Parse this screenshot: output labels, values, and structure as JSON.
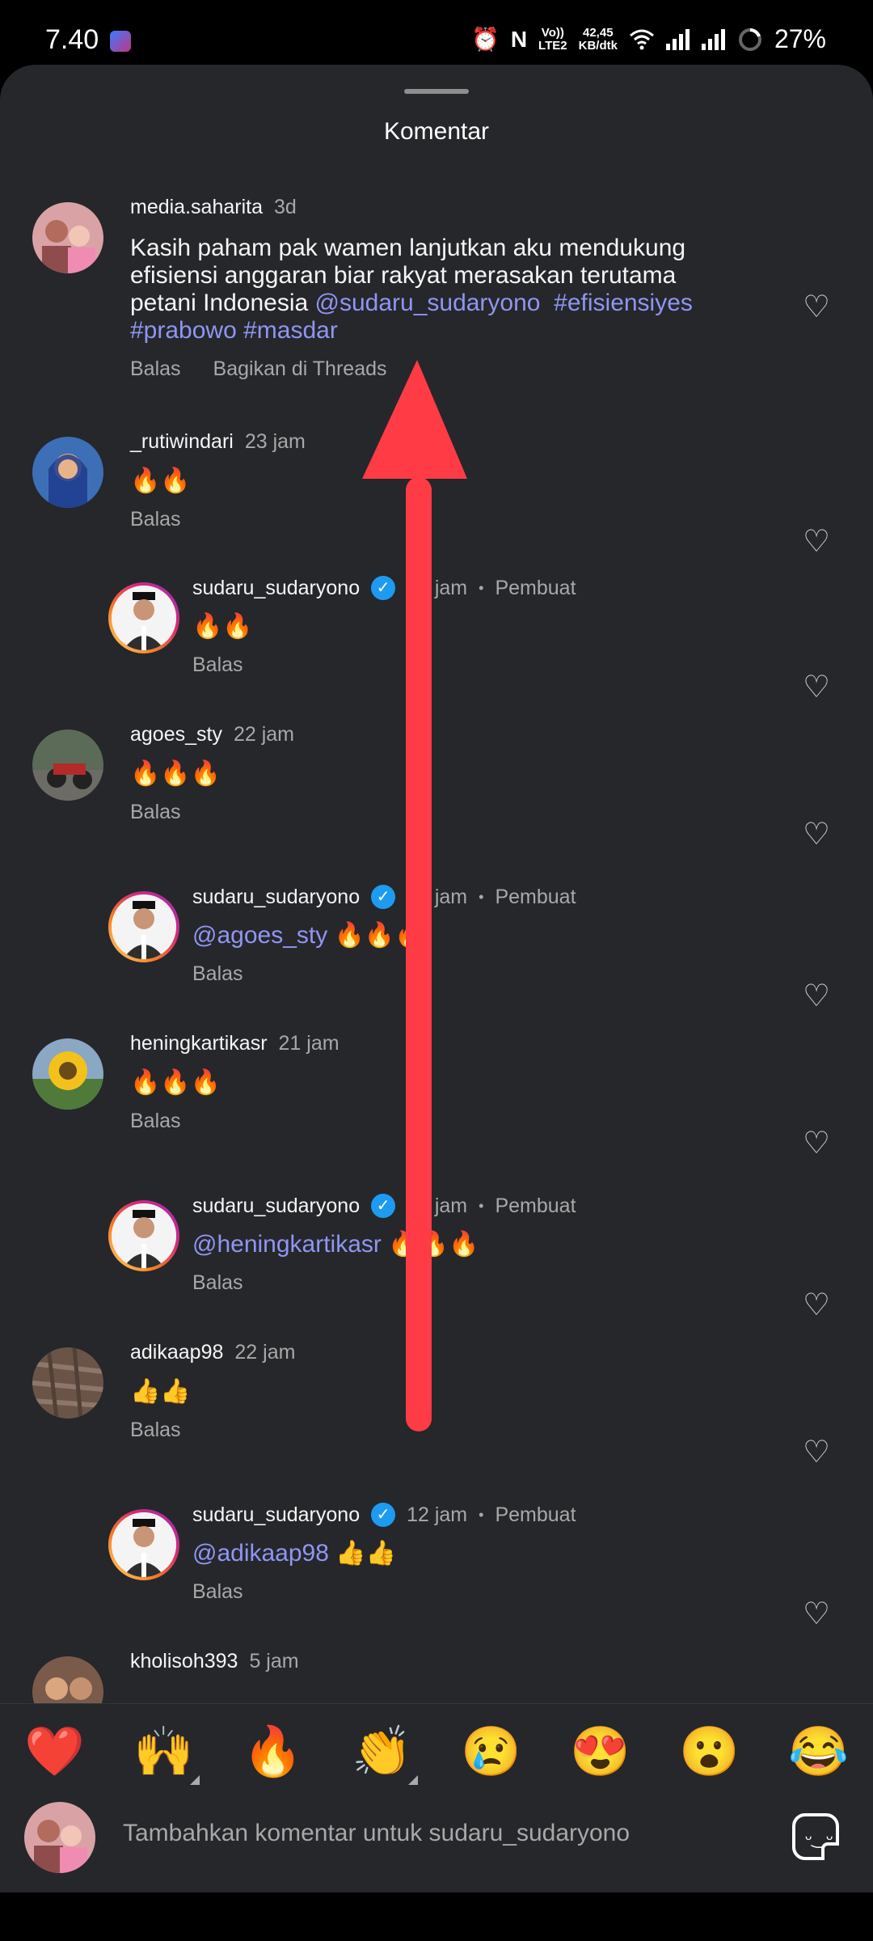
{
  "status": {
    "time": "7.40",
    "net_line1": "Vo))",
    "net_line2": "LTE2",
    "speed_line1": "42,45",
    "speed_line2": "KB/dtk",
    "battery": "27%"
  },
  "sheet": {
    "title": "Komentar"
  },
  "comments": [
    {
      "username": "media.saharita",
      "ago": "3d",
      "text_plain": "Kasih paham pak wamen lanjutkan aku mendukung efisiensi anggaran biar rakyat merasakan terutama petani Indonesia ",
      "mention": "@sudaru_sudaryono",
      "hashtag1": "#efisiensiyes",
      "hashtag2": "#prabowo",
      "hashtag3": "#masdar",
      "reply": "Balas",
      "share": "Bagikan di Threads"
    },
    {
      "username": "_rutiwindari",
      "ago": "23 jam",
      "text": "🔥🔥",
      "reply": "Balas"
    },
    {
      "username": "sudaru_sudaryono",
      "ago": "22 jam",
      "creator": "Pembuat",
      "text": "🔥🔥",
      "reply": "Balas"
    },
    {
      "username": "agoes_sty",
      "ago": "22 jam",
      "text": "🔥🔥🔥",
      "reply": "Balas"
    },
    {
      "username": "sudaru_sudaryono",
      "ago": "22 jam",
      "creator": "Pembuat",
      "mention": "@agoes_sty",
      "text": "🔥🔥🔥",
      "reply": "Balas"
    },
    {
      "username": "heningkartikasr",
      "ago": "21 jam",
      "text": "🔥🔥🔥",
      "reply": "Balas"
    },
    {
      "username": "sudaru_sudaryono",
      "ago": "13 jam",
      "creator": "Pembuat",
      "mention": "@heningkartikasr",
      "text": "🔥🔥🔥",
      "reply": "Balas"
    },
    {
      "username": "adikaap98",
      "ago": "22 jam",
      "text": "👍👍",
      "reply": "Balas"
    },
    {
      "username": "sudaru_sudaryono",
      "ago": "12 jam",
      "creator": "Pembuat",
      "mention": "@adikaap98",
      "text": "👍👍",
      "reply": "Balas"
    },
    {
      "username": "kholisoh393",
      "ago": "5 jam"
    }
  ],
  "reactions": [
    "❤️",
    "🙌",
    "🔥",
    "👏",
    "😢",
    "😍",
    "😮",
    "😂"
  ],
  "composer": {
    "placeholder": "Tambahkan komentar untuk sudaru_sudaryono"
  },
  "icons": {
    "heart": "heart-outline-icon",
    "verified": "verified-badge-icon",
    "sticker": "sticker-icon"
  },
  "colors": {
    "background": "#25272b",
    "link": "#8f96f0",
    "verified": "#1d9bf0",
    "arrow": "#ff3b45"
  }
}
